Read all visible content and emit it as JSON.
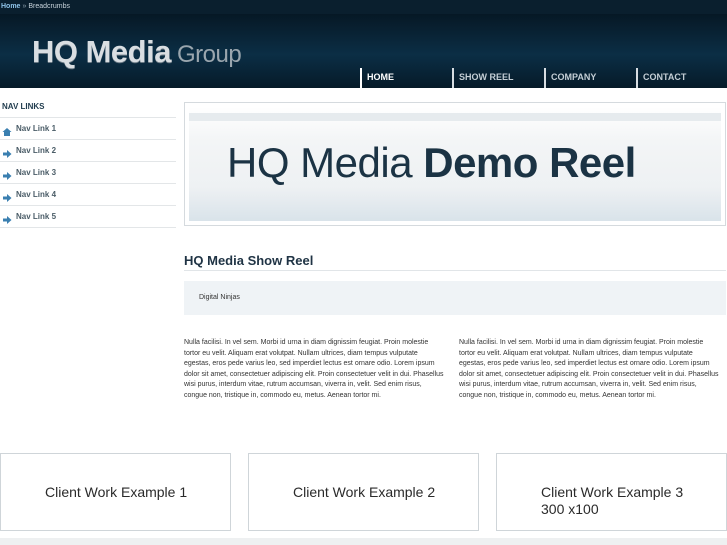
{
  "breadcrumb": {
    "home": "Home",
    "separator": "»",
    "current": "Breadcrumbs"
  },
  "logo": {
    "main": "HQ Media",
    "group": "Group"
  },
  "mainnav": [
    {
      "label": "HOME",
      "active": true
    },
    {
      "label": "SHOW REEL",
      "active": false
    },
    {
      "label": "COMPANY",
      "active": false
    },
    {
      "label": "CONTACT",
      "active": false
    }
  ],
  "sidebar": {
    "title": "NAV LINKS",
    "links": [
      {
        "label": "Nav Link 1",
        "icon": "home-icon"
      },
      {
        "label": "Nav Link 2",
        "icon": "arrow-right-icon"
      },
      {
        "label": "Nav Link 3",
        "icon": "arrow-right-icon"
      },
      {
        "label": "Nav Link 4",
        "icon": "arrow-right-icon"
      },
      {
        "label": "Nav Link 5",
        "icon": "arrow-right-icon"
      }
    ]
  },
  "banner": {
    "title_light": "HQ Media",
    "title_bold": "Demo Reel"
  },
  "section": {
    "title": "HQ Media Show Reel",
    "subtitle": "Digital Ninjas"
  },
  "body": {
    "col1": "Nulla facilisi. In vel sem. Morbi id urna in diam dignissim feugiat. Proin molestie tortor eu velit. Aliquam erat volutpat. Nullam ultrices, diam tempus vulputate egestas, eros pede varius leo, sed imperdiet lectus est ornare odio. Lorem ipsum dolor sit amet, consectetuer adipiscing elit. Proin consectetuer velit in dui. Phasellus wisi purus, interdum vitae, rutrum accumsan, viverra in, velit. Sed enim risus, congue non, tristique in, commodo eu, metus. Aenean tortor mi.",
    "col2": "Nulla facilisi. In vel sem. Morbi id urna in diam dignissim feugiat. Proin molestie tortor eu velit. Aliquam erat volutpat. Nullam ultrices, diam tempus vulputate egestas, eros pede varius leo, sed imperdiet lectus est ornare odio. Lorem ipsum dolor sit amet, consectetuer adipiscing elit. Proin consectetuer velit in dui. Phasellus wisi purus, interdum vitae, rutrum accumsan, viverra in, velit. Sed enim risus, congue non, tristique in, commodo eu, metus. Aenean tortor mi."
  },
  "examples": [
    {
      "line1": "Client Work Example 1",
      "line2": ""
    },
    {
      "line1": "Client Work Example 2",
      "line2": ""
    },
    {
      "line1": "Client Work Example 3",
      "line2": "300 x100"
    }
  ],
  "colors": {
    "header_dark": "#061825",
    "accent_link": "#8fc3e8",
    "nav_icon": "#3a7fb0"
  }
}
